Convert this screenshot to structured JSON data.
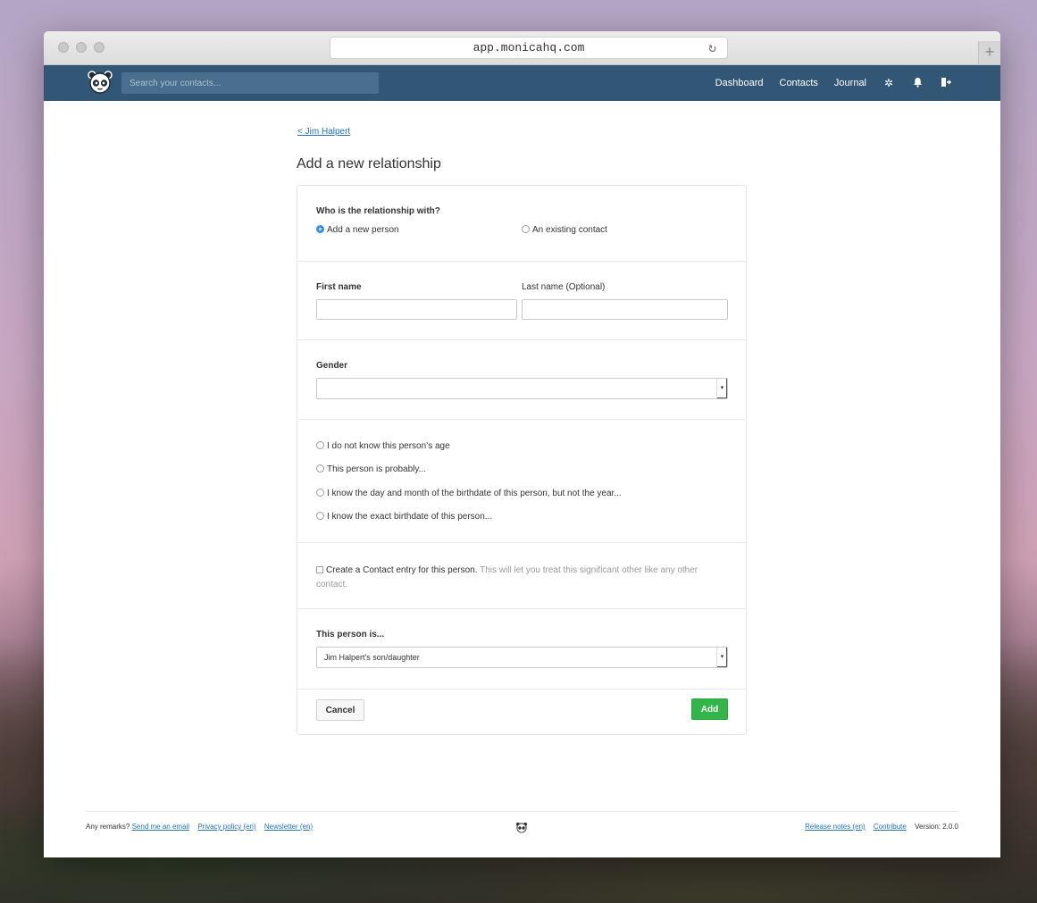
{
  "browser": {
    "url": "app.monicahq.com",
    "reload_icon": "reload-icon",
    "new_tab": "+"
  },
  "navbar": {
    "search_placeholder": "Search your contacts...",
    "links": [
      "Dashboard",
      "Contacts",
      "Journal"
    ],
    "icons": [
      "gear-icon",
      "bell-icon",
      "logout-icon"
    ]
  },
  "page": {
    "back_link": "< Jim Halpert",
    "title": "Add a new relationship"
  },
  "form": {
    "who_label": "Who is the relationship with?",
    "who_options": [
      {
        "label": "Add a new person",
        "checked": true
      },
      {
        "label": "An existing contact",
        "checked": false
      }
    ],
    "first_name_label": "First name",
    "last_name_label": "Last name (Optional)",
    "first_name_value": "",
    "last_name_value": "",
    "gender_label": "Gender",
    "gender_value": "",
    "age_options": [
      "I do not know this person’s age",
      "This person is probably...",
      "I know the day and month of the birthdate of this person, but not the year...",
      "I know the exact birthdate of this person..."
    ],
    "contact_entry_label": "Create a Contact entry for this person.",
    "contact_entry_help": "This will let you treat this significant other like any other contact.",
    "relation_label": "This person is...",
    "relation_value": "Jim Halpert's son/daughter",
    "cancel_label": "Cancel",
    "add_label": "Add"
  },
  "footer": {
    "remarks": "Any remarks?",
    "links_left": [
      "Send me an email",
      "Privacy policy (en)",
      "Newsletter (en)"
    ],
    "links_right": [
      "Release notes (en)",
      "Contribute"
    ],
    "version": "Version: 2.0.0"
  },
  "colors": {
    "navbar": "#325776",
    "link": "#2470b5",
    "add_button": "#33b54a",
    "radio_on": "#2f8ce8"
  }
}
